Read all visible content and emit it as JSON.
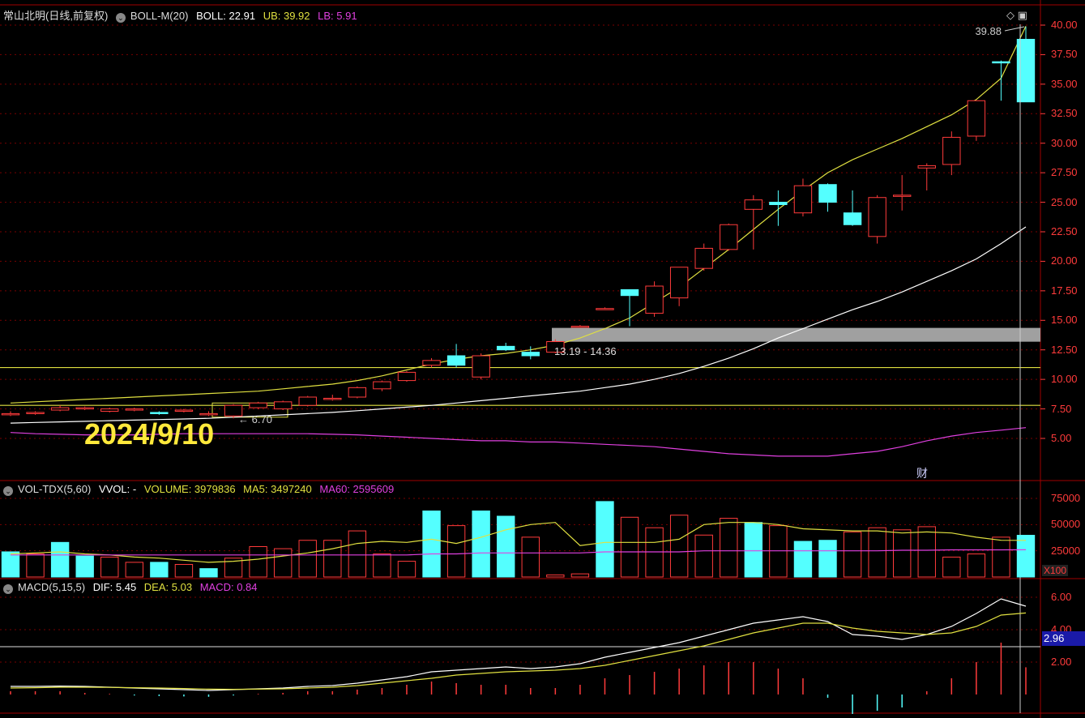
{
  "main_header": {
    "stock": "常山北明(日线,前复权)",
    "indicator": "BOLL-M(20)",
    "boll": "BOLL: 22.91",
    "ub": "UB: 39.92",
    "lb": "LB: 5.91"
  },
  "vol_header": {
    "indicator": "VOL-TDX(5,60)",
    "vvol": "VVOL: -",
    "volume": "VOLUME: 3979836",
    "ma5": "MA5: 3497240",
    "ma60": "MA60: 2595609"
  },
  "macd_header": {
    "indicator": "MACD(5,15,5)",
    "dif": "DIF: 5.45",
    "dea": "DEA: 5.03",
    "macd": "MACD: 0.84"
  },
  "annotations": {
    "date": "2024/9/10",
    "high_price": "39.88",
    "range": "13.19 - 14.36",
    "low_price": "6.70",
    "fin_mark": "财",
    "macd_cursor": "2.96",
    "vol_unit": "X100"
  },
  "price_axis": [
    "40.00",
    "37.50",
    "35.00",
    "32.50",
    "30.00",
    "27.50",
    "25.00",
    "22.50",
    "20.00",
    "17.50",
    "15.00",
    "12.50",
    "10.00",
    "7.50",
    "5.00"
  ],
  "vol_axis": [
    "75000",
    "50000",
    "25000"
  ],
  "macd_axis": [
    "6.00",
    "4.00",
    "2.00"
  ],
  "colors": {
    "up": "#ff3b3b",
    "down": "#54ffff",
    "ub_line": "#e0e040",
    "boll_line": "#ffffff",
    "lb_line": "#e040e0",
    "grid": "#7a0000"
  },
  "candles": [
    [
      7.0,
      7.3,
      6.9,
      7.1
    ],
    [
      7.1,
      7.3,
      7.0,
      7.2
    ],
    [
      7.4,
      7.8,
      7.3,
      7.6
    ],
    [
      7.5,
      7.7,
      7.4,
      7.6
    ],
    [
      7.3,
      7.6,
      7.2,
      7.5
    ],
    [
      7.4,
      7.6,
      7.3,
      7.5
    ],
    [
      7.2,
      7.3,
      7.0,
      7.1
    ],
    [
      7.3,
      7.5,
      7.2,
      7.4
    ],
    [
      7.1,
      7.3,
      6.9,
      7.1
    ],
    [
      6.9,
      7.9,
      6.7,
      7.8
    ],
    [
      7.6,
      8.1,
      7.5,
      8.0
    ],
    [
      7.5,
      8.2,
      7.4,
      8.1
    ],
    [
      7.8,
      8.6,
      7.7,
      8.5
    ],
    [
      8.4,
      8.7,
      8.2,
      8.4
    ],
    [
      8.5,
      9.4,
      8.4,
      9.3
    ],
    [
      9.2,
      9.9,
      9.0,
      9.8
    ],
    [
      9.9,
      10.7,
      9.8,
      10.6
    ],
    [
      11.2,
      11.8,
      11.0,
      11.6
    ],
    [
      12.0,
      13.0,
      11.0,
      11.2
    ],
    [
      10.2,
      12.2,
      10.0,
      12.0
    ],
    [
      12.8,
      13.1,
      12.4,
      12.5
    ],
    [
      12.3,
      12.8,
      11.7,
      12.0
    ],
    [
      12.3,
      13.4,
      12.2,
      13.2
    ],
    [
      14.5,
      14.6,
      14.4,
      14.5
    ],
    [
      16.0,
      16.1,
      15.9,
      16.0
    ],
    [
      17.6,
      17.6,
      14.5,
      17.1
    ],
    [
      15.6,
      18.3,
      15.3,
      17.9
    ],
    [
      16.9,
      19.5,
      16.2,
      19.5
    ],
    [
      19.4,
      21.5,
      19.2,
      21.1
    ],
    [
      21.0,
      23.2,
      20.9,
      23.1
    ],
    [
      24.4,
      25.6,
      21.0,
      25.2
    ],
    [
      25.0,
      26.0,
      23.0,
      24.8
    ],
    [
      24.1,
      27.0,
      23.8,
      26.4
    ],
    [
      26.5,
      26.6,
      24.2,
      25.0
    ],
    [
      24.1,
      26.0,
      23.0,
      23.1
    ],
    [
      22.1,
      25.6,
      21.5,
      25.4
    ],
    [
      25.6,
      27.3,
      24.3,
      25.6
    ],
    [
      27.9,
      28.3,
      26.0,
      28.1
    ],
    [
      28.2,
      31.0,
      27.3,
      30.5
    ],
    [
      30.6,
      33.6,
      30.2,
      33.6
    ],
    [
      36.9,
      37.0,
      33.6,
      36.8
    ],
    [
      38.8,
      39.88,
      33.5,
      33.5
    ]
  ],
  "ub_values": [
    8.0,
    8.1,
    8.2,
    8.3,
    8.4,
    8.5,
    8.6,
    8.7,
    8.8,
    8.9,
    9.0,
    9.2,
    9.4,
    9.6,
    9.9,
    10.3,
    10.8,
    11.3,
    11.7,
    12.0,
    12.2,
    12.5,
    12.9,
    13.5,
    14.3,
    15.2,
    16.5,
    17.8,
    19.4,
    21.0,
    22.7,
    24.4,
    26.0,
    27.5,
    28.6,
    29.5,
    30.4,
    31.4,
    32.4,
    33.7,
    35.5,
    39.92
  ],
  "boll_values": [
    6.3,
    6.35,
    6.4,
    6.45,
    6.5,
    6.55,
    6.6,
    6.65,
    6.7,
    6.8,
    6.9,
    7.0,
    7.1,
    7.2,
    7.35,
    7.5,
    7.65,
    7.8,
    8.0,
    8.2,
    8.4,
    8.6,
    8.8,
    9.0,
    9.3,
    9.6,
    10.0,
    10.5,
    11.1,
    11.8,
    12.6,
    13.5,
    14.3,
    15.1,
    15.9,
    16.6,
    17.4,
    18.3,
    19.2,
    20.2,
    21.5,
    22.91
  ],
  "lb_values": [
    5.5,
    5.4,
    5.35,
    5.3,
    5.3,
    5.3,
    5.35,
    5.4,
    5.4,
    5.4,
    5.4,
    5.4,
    5.4,
    5.35,
    5.3,
    5.2,
    5.1,
    5.0,
    4.9,
    4.8,
    4.8,
    4.7,
    4.7,
    4.6,
    4.5,
    4.4,
    4.3,
    4.1,
    3.9,
    3.7,
    3.6,
    3.5,
    3.5,
    3.5,
    3.7,
    3.9,
    4.3,
    4.8,
    5.2,
    5.5,
    5.7,
    5.91
  ],
  "volumes": [
    24000,
    22000,
    33000,
    20000,
    19000,
    14000,
    14000,
    12000,
    8000,
    18000,
    29000,
    27000,
    35000,
    35000,
    44000,
    22000,
    15000,
    63000,
    49000,
    63000,
    58000,
    38000,
    2000,
    3000,
    72000,
    57000,
    47000,
    59000,
    40000,
    56000,
    52000,
    49000,
    34000,
    35000,
    43000,
    47000,
    45000,
    48000,
    19000,
    22000,
    38000,
    39800
  ],
  "vol_up": [
    false,
    true,
    false,
    false,
    true,
    true,
    false,
    true,
    false,
    true,
    true,
    true,
    true,
    true,
    true,
    true,
    true,
    false,
    true,
    false,
    false,
    true,
    true,
    true,
    false,
    true,
    true,
    true,
    true,
    true,
    false,
    true,
    false,
    false,
    true,
    true,
    true,
    true,
    true,
    true,
    true,
    false
  ],
  "vol_ma5": [
    22000,
    23000,
    24000,
    22000,
    21000,
    19000,
    18000,
    16000,
    14000,
    15000,
    17000,
    20000,
    23000,
    27000,
    32000,
    34000,
    33000,
    36000,
    32000,
    38000,
    45000,
    50000,
    52000,
    30000,
    33000,
    33000,
    33000,
    36000,
    50000,
    52000,
    52000,
    50000,
    46000,
    45000,
    44000,
    44000,
    42000,
    43000,
    42000,
    38000,
    35000,
    34972
  ],
  "vol_ma60": [
    21000,
    21000,
    21000,
    21000,
    21000,
    21000,
    21000,
    21000,
    21000,
    21000,
    21000,
    21000,
    21000,
    21000,
    21000,
    21000,
    21000,
    22000,
    22000,
    23000,
    23000,
    23000,
    23000,
    23000,
    24000,
    24000,
    24000,
    24000,
    25000,
    25000,
    25000,
    25000,
    25000,
    25000,
    25000,
    25000,
    25500,
    25500,
    25900,
    25900,
    25900,
    25960
  ],
  "dif_values": [
    0.5,
    0.5,
    0.52,
    0.5,
    0.45,
    0.4,
    0.35,
    0.3,
    0.25,
    0.3,
    0.35,
    0.4,
    0.5,
    0.55,
    0.7,
    0.9,
    1.1,
    1.4,
    1.5,
    1.6,
    1.7,
    1.6,
    1.7,
    1.9,
    2.3,
    2.6,
    2.9,
    3.2,
    3.6,
    4.0,
    4.4,
    4.6,
    4.8,
    4.5,
    3.7,
    3.6,
    3.4,
    3.7,
    4.2,
    5.0,
    5.9,
    5.45
  ],
  "dea_values": [
    0.4,
    0.42,
    0.45,
    0.45,
    0.44,
    0.42,
    0.4,
    0.37,
    0.33,
    0.32,
    0.33,
    0.35,
    0.4,
    0.45,
    0.55,
    0.7,
    0.85,
    1.0,
    1.2,
    1.3,
    1.4,
    1.45,
    1.5,
    1.6,
    1.8,
    2.1,
    2.4,
    2.7,
    3.0,
    3.4,
    3.8,
    4.1,
    4.4,
    4.4,
    4.1,
    3.9,
    3.8,
    3.7,
    3.8,
    4.2,
    4.9,
    5.03
  ],
  "macd_bars": [
    0.1,
    0.1,
    0.1,
    0.05,
    0.02,
    -0.03,
    -0.05,
    -0.06,
    -0.07,
    -0.03,
    0.02,
    0.05,
    0.1,
    0.1,
    0.15,
    0.2,
    0.3,
    0.4,
    0.35,
    0.3,
    0.3,
    0.2,
    0.2,
    0.3,
    0.5,
    0.6,
    0.7,
    0.8,
    0.9,
    1.0,
    1.0,
    0.8,
    0.5,
    -0.1,
    -0.6,
    -0.5,
    -0.4,
    0.1,
    0.5,
    1.0,
    1.6,
    0.84
  ]
}
